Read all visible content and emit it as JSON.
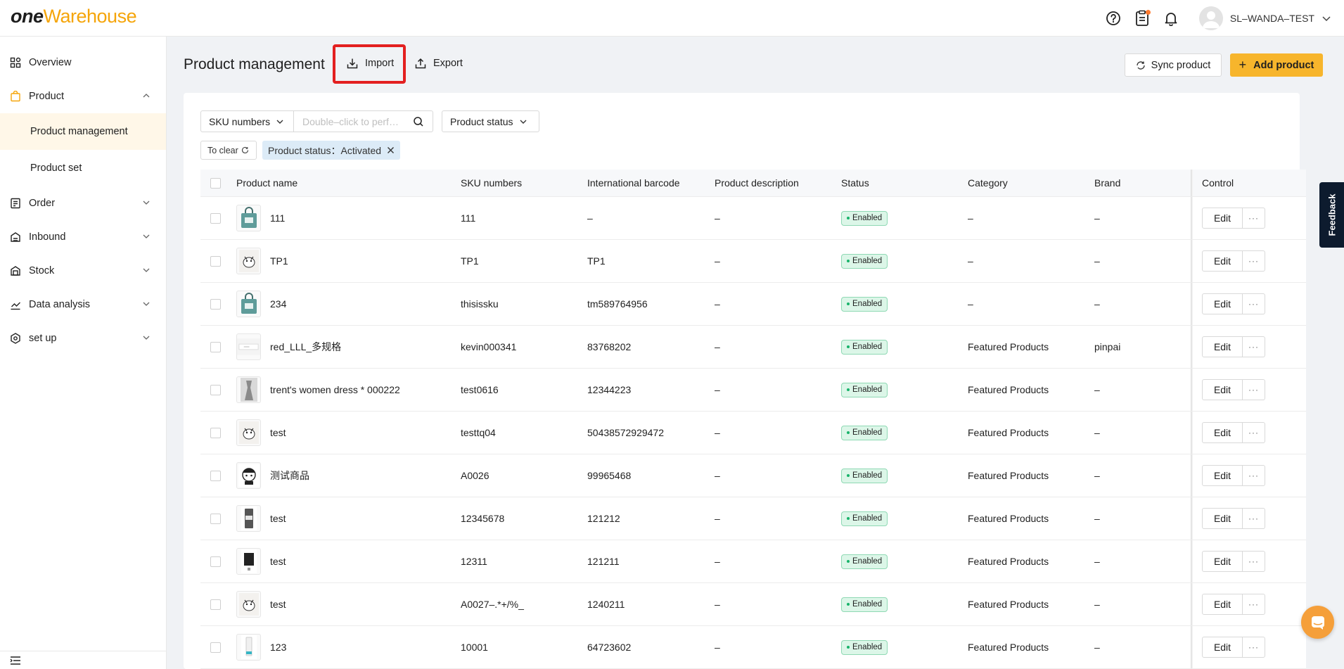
{
  "brand": {
    "logo_one": "one",
    "logo_warehouse": "Warehouse",
    "accent_color": "#f7b52c"
  },
  "header": {
    "user_name": "SL–WANDA–TEST",
    "icons": [
      "help-icon",
      "clipboard-icon",
      "bell-icon"
    ]
  },
  "sidebar": {
    "items": [
      {
        "label": "Overview"
      },
      {
        "label": "Product"
      },
      {
        "label": "Product management"
      },
      {
        "label": "Product set"
      },
      {
        "label": "Order"
      },
      {
        "label": "Inbound"
      },
      {
        "label": "Stock"
      },
      {
        "label": "Data analysis"
      },
      {
        "label": "set up"
      }
    ]
  },
  "page": {
    "title": "Product management",
    "import_label": "Import",
    "export_label": "Export",
    "sync_label": "Sync product",
    "add_label": "Add product"
  },
  "filters": {
    "sku_select": "SKU numbers",
    "search_placeholder": "Double–click to perf…",
    "status_select": "Product status",
    "clear_label": "To clear",
    "active_tag": "Product status：Activated"
  },
  "table": {
    "columns": [
      "Product name",
      "SKU numbers",
      "International barcode",
      "Product description",
      "Status",
      "Category",
      "Brand",
      "Control"
    ],
    "edit_label": "Edit",
    "more_label": "···",
    "rows": [
      {
        "name": "111",
        "sku": "111",
        "barcode": "–",
        "desc": "–",
        "status": "Enabled",
        "category": "–",
        "brand": "–"
      },
      {
        "name": "TP1",
        "sku": "TP1",
        "barcode": "TP1",
        "desc": "–",
        "status": "Enabled",
        "category": "–",
        "brand": "–"
      },
      {
        "name": "234",
        "sku": "thisissku",
        "barcode": "tm589764956",
        "desc": "–",
        "status": "Enabled",
        "category": "–",
        "brand": "–"
      },
      {
        "name": "red_LLL_多规格",
        "sku": "kevin000341",
        "barcode": "83768202",
        "desc": "–",
        "status": "Enabled",
        "category": "Featured Products",
        "brand": "pinpai"
      },
      {
        "name": "trent's women dress * 000222",
        "sku": "test0616",
        "barcode": "12344223",
        "desc": "–",
        "status": "Enabled",
        "category": "Featured Products",
        "brand": "–"
      },
      {
        "name": "test",
        "sku": "testtq04",
        "barcode": "50438572929472",
        "desc": "–",
        "status": "Enabled",
        "category": "Featured Products",
        "brand": "–"
      },
      {
        "name": "测试商品",
        "sku": "A0026",
        "barcode": "99965468",
        "desc": "–",
        "status": "Enabled",
        "category": "Featured Products",
        "brand": "–"
      },
      {
        "name": "test",
        "sku": "12345678",
        "barcode": "121212",
        "desc": "–",
        "status": "Enabled",
        "category": "Featured Products",
        "brand": "–"
      },
      {
        "name": "test",
        "sku": "12311",
        "barcode": "121211",
        "desc": "–",
        "status": "Enabled",
        "category": "Featured Products",
        "brand": "–"
      },
      {
        "name": "test",
        "sku": "A0027–.*+/%_",
        "barcode": "1240211",
        "desc": "–",
        "status": "Enabled",
        "category": "Featured Products",
        "brand": "–"
      },
      {
        "name": "123",
        "sku": "10001",
        "barcode": "64723602",
        "desc": "–",
        "status": "Enabled",
        "category": "Featured Products",
        "brand": "–"
      }
    ]
  },
  "feedback_label": "Feedback"
}
